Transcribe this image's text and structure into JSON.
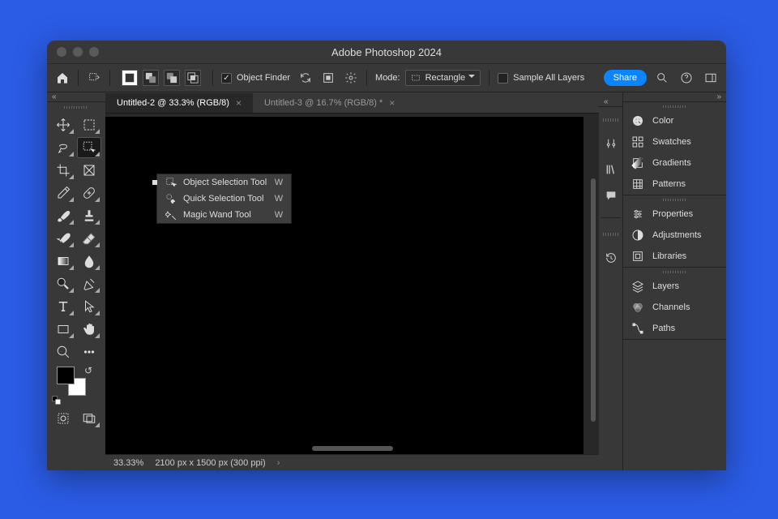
{
  "title": "Adobe Photoshop 2024",
  "options_bar": {
    "object_finder": "Object Finder",
    "mode_label": "Mode:",
    "mode_value": "Rectangle",
    "sample_all": "Sample All Layers",
    "share": "Share"
  },
  "tabs": [
    {
      "label": "Untitled-2 @ 33.3% (RGB/8)",
      "active": true
    },
    {
      "label": "Untitled-3 @ 16.7% (RGB/8) *",
      "active": false
    }
  ],
  "status": {
    "zoom": "33.33%",
    "dims": "2100 px x 1500 px (300 ppi)"
  },
  "flyout": [
    {
      "label": "Object Selection Tool",
      "key": "W",
      "current": true
    },
    {
      "label": "Quick Selection Tool",
      "key": "W",
      "current": false
    },
    {
      "label": "Magic Wand Tool",
      "key": "W",
      "current": false
    }
  ],
  "panels": {
    "g1": [
      "Color",
      "Swatches",
      "Gradients",
      "Patterns"
    ],
    "g2": [
      "Properties",
      "Adjustments",
      "Libraries"
    ],
    "g3": [
      "Layers",
      "Channels",
      "Paths"
    ]
  },
  "colors": {
    "fg": "#000000",
    "bg": "#ffffff",
    "accent": "#0a84ff"
  }
}
